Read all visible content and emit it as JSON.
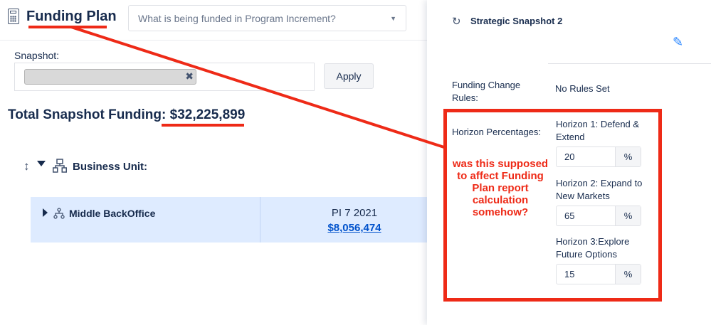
{
  "header": {
    "title": "Funding Plan",
    "program_increment_placeholder": "What is being funded in Program Increment?"
  },
  "snapshot": {
    "label": "Snapshot:",
    "apply_label": "Apply"
  },
  "total": {
    "label": "Total Snapshot Funding:",
    "amount": "$32,225,899"
  },
  "hierarchy": {
    "group_label": "Business Unit:",
    "rows": [
      {
        "name": "Middle BackOffice",
        "pi": "PI 7 2021",
        "amount": "$8,056,474"
      }
    ]
  },
  "panel": {
    "title": "Strategic Snapshot 2",
    "funding_change_rules_label": "Funding Change Rules:",
    "funding_change_rules_value": "No Rules Set",
    "horizon_percentages_label": "Horizon Percentages:",
    "horizons": [
      {
        "label": "Horizon 1: Defend & Extend",
        "value": "20",
        "unit": "%"
      },
      {
        "label": "Horizon 2: Expand to New Markets",
        "value": "65",
        "unit": "%"
      },
      {
        "label": "Horizon 3:Explore Future Options",
        "value": "15",
        "unit": "%"
      }
    ]
  },
  "annotation": {
    "text": "was this supposed to affect Funding Plan report calculation somehow?",
    "color": "#ee2a17"
  },
  "icons": {
    "calculator": "calculator-icon",
    "dropdown": "chevron-down-icon",
    "remove": "close-icon",
    "sort": "sort-vertical-icon",
    "expand_down": "caret-down-icon",
    "expand_right": "caret-right-icon",
    "hierarchy": "org-hierarchy-icon",
    "refresh": "refresh-icon",
    "edit": "pencil-icon"
  },
  "colors": {
    "row_highlight": "#deebff",
    "link": "#0052cc",
    "text": "#172b4d"
  }
}
